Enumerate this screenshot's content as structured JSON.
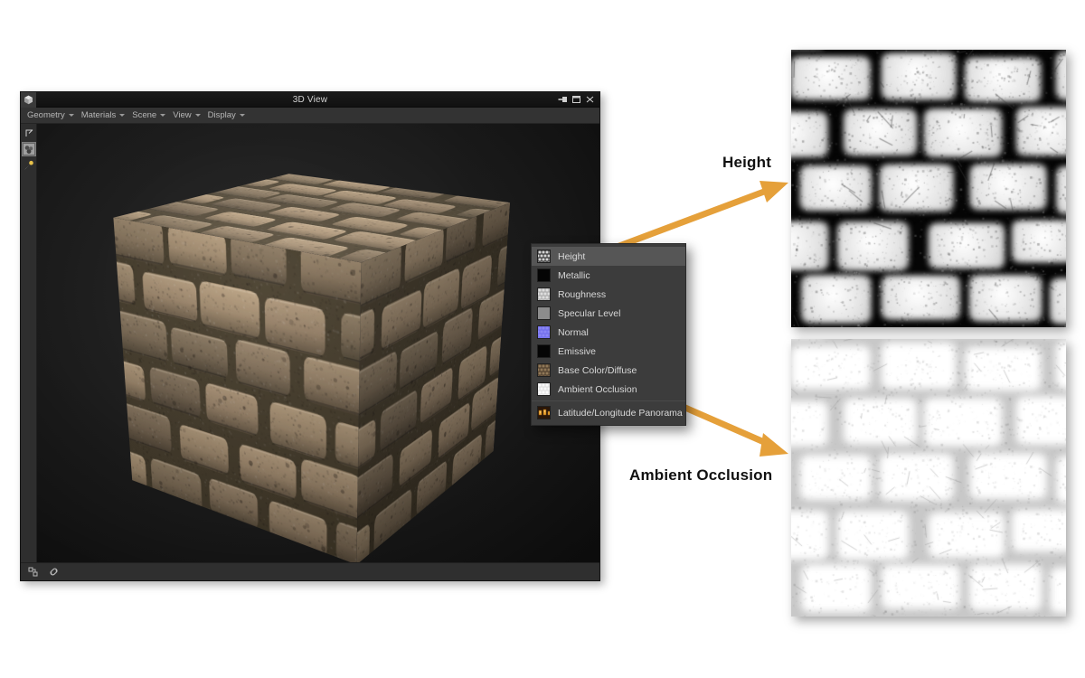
{
  "viewport": {
    "title": "3D View",
    "app_icon": "cube-icon",
    "title_buttons": [
      {
        "name": "pin-panel-button",
        "icon": "pin-icon"
      },
      {
        "name": "maximize-panel-button",
        "icon": "restore-icon"
      },
      {
        "name": "close-panel-button",
        "icon": "close-icon"
      }
    ],
    "menus": [
      {
        "label": "Geometry"
      },
      {
        "label": "Materials"
      },
      {
        "label": "Scene"
      },
      {
        "label": "View"
      },
      {
        "label": "Display"
      }
    ],
    "left_tools": [
      {
        "name": "expand-view-tool",
        "icon": "expand-icon",
        "active": false
      },
      {
        "name": "material-preview-tool",
        "icon": "material-ball-icon",
        "active": true
      },
      {
        "name": "light-tool",
        "icon": "light-bulb-icon",
        "active": false
      }
    ],
    "status_tools": [
      {
        "name": "scene-node-tool",
        "icon": "node-icon"
      },
      {
        "name": "link-tool",
        "icon": "link-icon"
      }
    ]
  },
  "channel_menu": {
    "selected": "Height",
    "items": [
      {
        "label": "Height",
        "swatch": "height-swatch",
        "selected": true
      },
      {
        "label": "Metallic",
        "swatch": "metallic-swatch",
        "selected": false
      },
      {
        "label": "Roughness",
        "swatch": "roughness-swatch",
        "selected": false
      },
      {
        "label": "Specular Level",
        "swatch": "specular-swatch",
        "selected": false
      },
      {
        "label": "Normal",
        "swatch": "normal-swatch",
        "selected": false
      },
      {
        "label": "Emissive",
        "swatch": "emissive-swatch",
        "selected": false
      },
      {
        "label": "Base Color/Diffuse",
        "swatch": "basecolor-swatch",
        "selected": false
      },
      {
        "label": "Ambient Occlusion",
        "swatch": "ao-swatch",
        "selected": false
      }
    ],
    "footer_items": [
      {
        "label": "Latitude/Longitude Panorama",
        "swatch": "panorama-swatch",
        "selected": false
      }
    ]
  },
  "annotations": [
    {
      "name": "height-callout",
      "label": "Height"
    },
    {
      "name": "ambient-occlusion-callout",
      "label": "Ambient Occlusion"
    }
  ],
  "previews": [
    {
      "name": "height-map-preview",
      "channel": "Height"
    },
    {
      "name": "ambient-occlusion-map-preview",
      "channel": "Ambient Occlusion"
    }
  ],
  "colors": {
    "accent_orange": "#E5A03A",
    "panel_bg": "#2b2b2b",
    "menu_bg": "#3c3c3c",
    "menu_selected": "#565656",
    "canvas_bg": "#1a1a1a",
    "text": "#d8d8d8",
    "label_text": "#111111"
  }
}
